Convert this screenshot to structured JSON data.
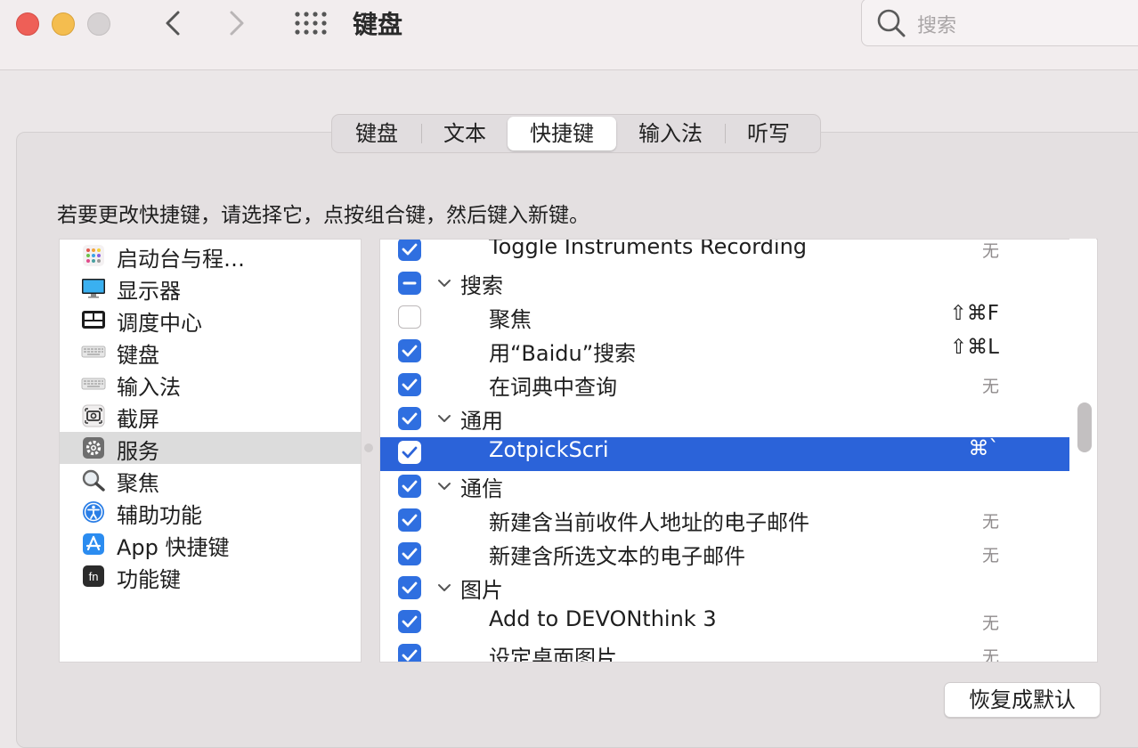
{
  "window": {
    "title": "键盘",
    "search_placeholder": "搜索"
  },
  "tabs": [
    {
      "label": "键盘",
      "active": false
    },
    {
      "label": "文本",
      "active": false
    },
    {
      "label": "快捷键",
      "active": true
    },
    {
      "label": "输入法",
      "active": false
    },
    {
      "label": "听写",
      "active": false
    }
  ],
  "instruction": "若要更改快捷键，请选择它，点按组合键，然后键入新键。",
  "categories": [
    {
      "label": "启动台与程…",
      "icon": "launchpad-icon",
      "selected": false
    },
    {
      "label": "显示器",
      "icon": "display-icon",
      "selected": false
    },
    {
      "label": "调度中心",
      "icon": "mission-control-icon",
      "selected": false
    },
    {
      "label": "键盘",
      "icon": "keyboard-icon",
      "selected": false
    },
    {
      "label": "输入法",
      "icon": "keyboard-icon",
      "selected": false
    },
    {
      "label": "截屏",
      "icon": "screenshot-icon",
      "selected": false
    },
    {
      "label": "服务",
      "icon": "gear-icon",
      "selected": true
    },
    {
      "label": "聚焦",
      "icon": "magnifier-icon",
      "selected": false
    },
    {
      "label": "辅助功能",
      "icon": "accessibility-icon",
      "selected": false
    },
    {
      "label": "App 快捷键",
      "icon": "app-store-icon",
      "selected": false
    },
    {
      "label": "功能键",
      "icon": "fn-key-icon",
      "selected": false
    }
  ],
  "shortcuts": [
    {
      "label": "Toggle Instruments Recording",
      "kind": "leaf",
      "state": "on",
      "shortcut": "无",
      "none": true,
      "selected": false
    },
    {
      "label": "搜索",
      "kind": "group",
      "state": "mixed",
      "shortcut": "",
      "none": false,
      "selected": false
    },
    {
      "label": "聚焦",
      "kind": "leaf",
      "state": "off",
      "shortcut": "⇧⌘F",
      "none": false,
      "selected": false
    },
    {
      "label": "用“Baidu”搜索",
      "kind": "leaf",
      "state": "on",
      "shortcut": "⇧⌘L",
      "none": false,
      "selected": false
    },
    {
      "label": "在词典中查询",
      "kind": "leaf",
      "state": "on",
      "shortcut": "无",
      "none": true,
      "selected": false
    },
    {
      "label": "通用",
      "kind": "group",
      "state": "on",
      "shortcut": "",
      "none": false,
      "selected": false
    },
    {
      "label": "ZotpickScri",
      "kind": "leaf",
      "state": "on",
      "shortcut": "⌘`",
      "none": false,
      "selected": true
    },
    {
      "label": "通信",
      "kind": "group",
      "state": "on",
      "shortcut": "",
      "none": false,
      "selected": false
    },
    {
      "label": "新建含当前收件人地址的电子邮件",
      "kind": "leaf",
      "state": "on",
      "shortcut": "无",
      "none": true,
      "selected": false
    },
    {
      "label": "新建含所选文本的电子邮件",
      "kind": "leaf",
      "state": "on",
      "shortcut": "无",
      "none": true,
      "selected": false
    },
    {
      "label": "图片",
      "kind": "group",
      "state": "on",
      "shortcut": "",
      "none": false,
      "selected": false
    },
    {
      "label": "Add to DEVONthink 3",
      "kind": "leaf",
      "state": "on",
      "shortcut": "无",
      "none": true,
      "selected": false
    },
    {
      "label": "设定桌面图片",
      "kind": "leaf",
      "state": "on",
      "shortcut": "无",
      "none": true,
      "selected": false
    }
  ],
  "restore_button": "恢复成默认",
  "colors": {
    "accent": "#2f6fe0",
    "selection": "#2b63d9",
    "background": "#ebe7e8"
  }
}
